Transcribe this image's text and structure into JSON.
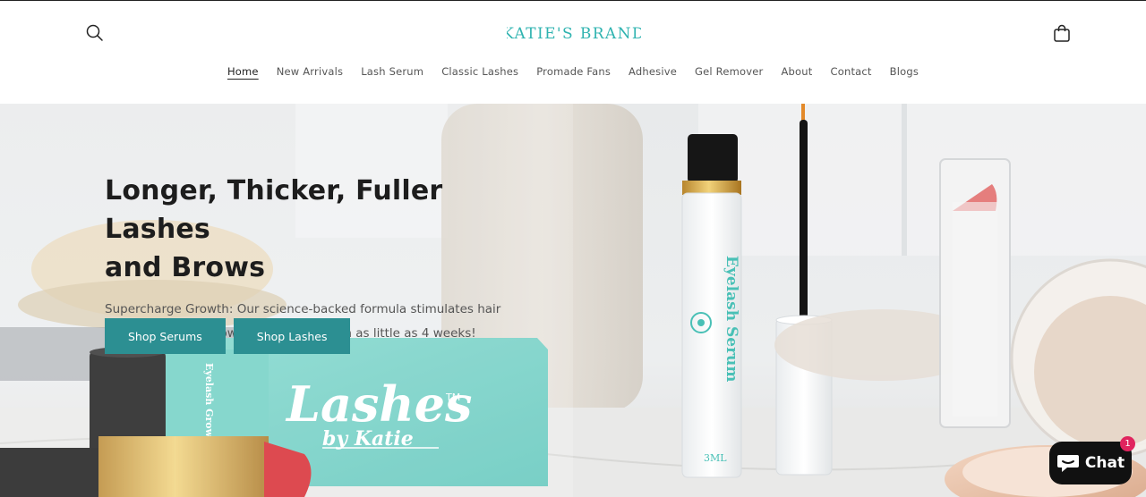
{
  "header": {
    "logo_text": "KATIE'S BRAND",
    "search_label": "Search",
    "cart_label": "Cart"
  },
  "nav": {
    "items": [
      {
        "label": "Home"
      },
      {
        "label": "New Arrivals"
      },
      {
        "label": "Lash Serum"
      },
      {
        "label": "Classic Lashes"
      },
      {
        "label": "Promade Fans"
      },
      {
        "label": "Adhesive"
      },
      {
        "label": "Gel Remover"
      },
      {
        "label": "About"
      },
      {
        "label": "Contact"
      },
      {
        "label": "Blogs"
      }
    ]
  },
  "hero": {
    "title_line1": "Longer, Thicker, Fuller Lashes",
    "title_line2": "and Brows",
    "subtitle": "Supercharge Growth: Our science-backed formula stimulates hair follicles to boost growth and thickness in as little as 4 weeks!",
    "buttons": [
      {
        "label": "Shop Serums"
      },
      {
        "label": "Shop Lashes"
      }
    ],
    "product_box_brand": "Lashes",
    "product_box_tagline": "by Katie",
    "product_box_tm": "TM",
    "product_box_side": "Eyelash Growth Serum",
    "serum_tube_label": "Eyelash Serum",
    "serum_tube_volume": "3ML"
  },
  "chat_widget": {
    "label": "Chat",
    "badge_count": "1"
  },
  "colors": {
    "brand_teal": "#2fb3b0",
    "button_teal": "#2c8f92",
    "chat_bg": "#111111",
    "badge": "#e0245e"
  }
}
